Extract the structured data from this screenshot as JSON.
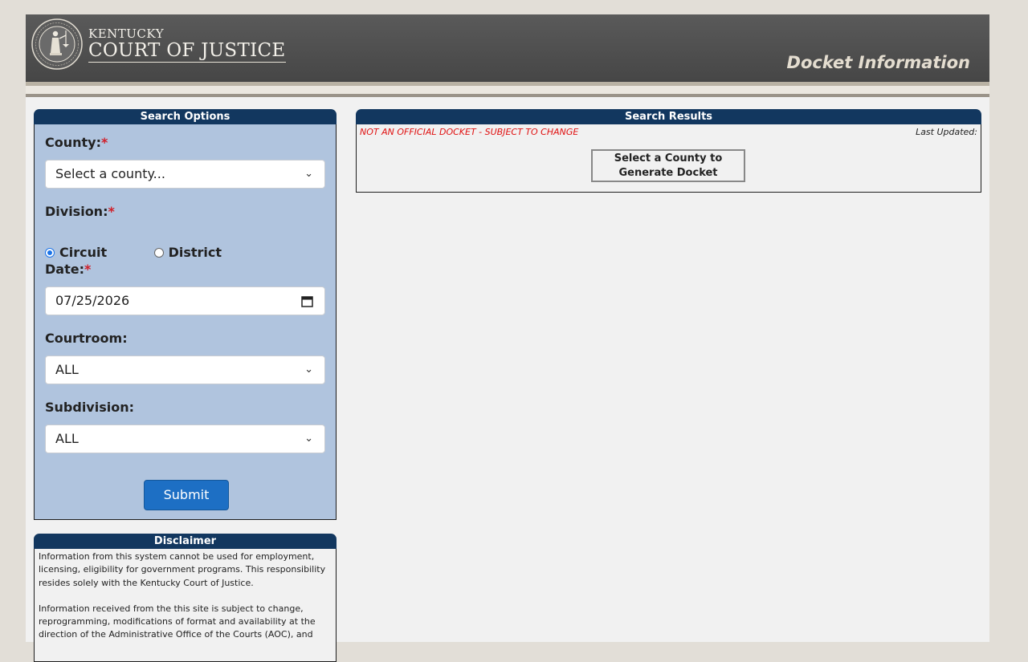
{
  "header": {
    "logo_line1": "KENTUCKY",
    "logo_line2": "COURT OF JUSTICE",
    "page_title": "Docket Information"
  },
  "search": {
    "heading": "Search Options",
    "county_label": "County:",
    "county_value": "Select a county...",
    "division_label": "Division:",
    "division_options": [
      "Circuit",
      "District"
    ],
    "division_selected": "Circuit",
    "date_label": "Date:",
    "date_value": "07/25/2026",
    "courtroom_label": "Courtroom:",
    "courtroom_value": "ALL",
    "subdivision_label": "Subdivision:",
    "subdivision_value": "ALL",
    "required_marker": "*",
    "submit_label": "Submit"
  },
  "disclaimer": {
    "heading": "Disclaimer",
    "paragraphs": [
      "Information from this system cannot be used for employment, licensing, eligibility for government programs. This responsibility resides solely with the Kentucky Court of Justice.",
      "Information received from the this site is subject to change, reprogramming, modifications of format and availability at the direction of the Administrative Office of the Courts (AOC), and"
    ]
  },
  "results": {
    "heading": "Search Results",
    "notice": "NOT AN OFFICIAL DOCKET - SUBJECT TO CHANGE",
    "last_updated_label": "Last Updated:",
    "generate_line1": "Select a County to",
    "generate_line2": "Generate Docket"
  },
  "icons": {
    "seal": "court-seal-icon",
    "dropdown": "chevron-down-icon",
    "calendar": "calendar-icon"
  },
  "colors": {
    "header_bg": "#4e4e4e",
    "panel_head": "#12375f",
    "search_bg": "#b0c4de",
    "submit_bg": "#1d6fc4",
    "notice_red": "#e01010"
  }
}
